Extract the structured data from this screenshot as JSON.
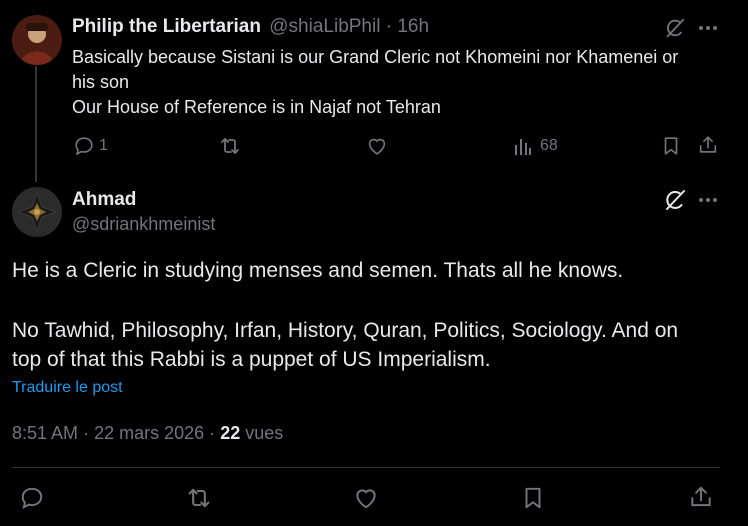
{
  "reply_tweet": {
    "display_name": "Philip the Libertarian",
    "handle": "@shiaLibPhil",
    "separator": "·",
    "time": "16h",
    "lines": [
      "Basically because Sistani is our Grand Cleric not Khomeini nor Khamenei or",
      "his son",
      "Our House of Reference is in Najaf not Tehran"
    ],
    "actions": {
      "reply_count": "1",
      "views_count": "68"
    }
  },
  "main_tweet": {
    "display_name": "Ahmad",
    "handle": "@sdriankhmeinist",
    "paragraph1": "He is a Cleric in studying menses and semen. Thats all he knows.",
    "paragraph2_line1": "No Tawhid, Philosophy, Irfan, History, Quran, Politics, Sociology. And on",
    "paragraph2_line2": "top of that this Rabbi is a puppet of US Imperialism.",
    "translate_label": "Traduire le post",
    "meta": {
      "time": "8:51 AM",
      "sep1": "·",
      "date": "22 mars 2026",
      "sep2": "·",
      "views_count": "22",
      "views_label": "vues"
    }
  },
  "colors": {
    "background": "#000000",
    "text": "#e7e9ea",
    "muted": "#71767b",
    "link": "#1d9bf0",
    "divider": "#2f3336"
  },
  "icons": {
    "grok": "grok-icon",
    "more": "more-icon",
    "reply": "reply-icon",
    "retweet": "retweet-icon",
    "like": "like-icon",
    "views": "views-icon",
    "bookmark": "bookmark-icon",
    "share": "share-icon"
  }
}
